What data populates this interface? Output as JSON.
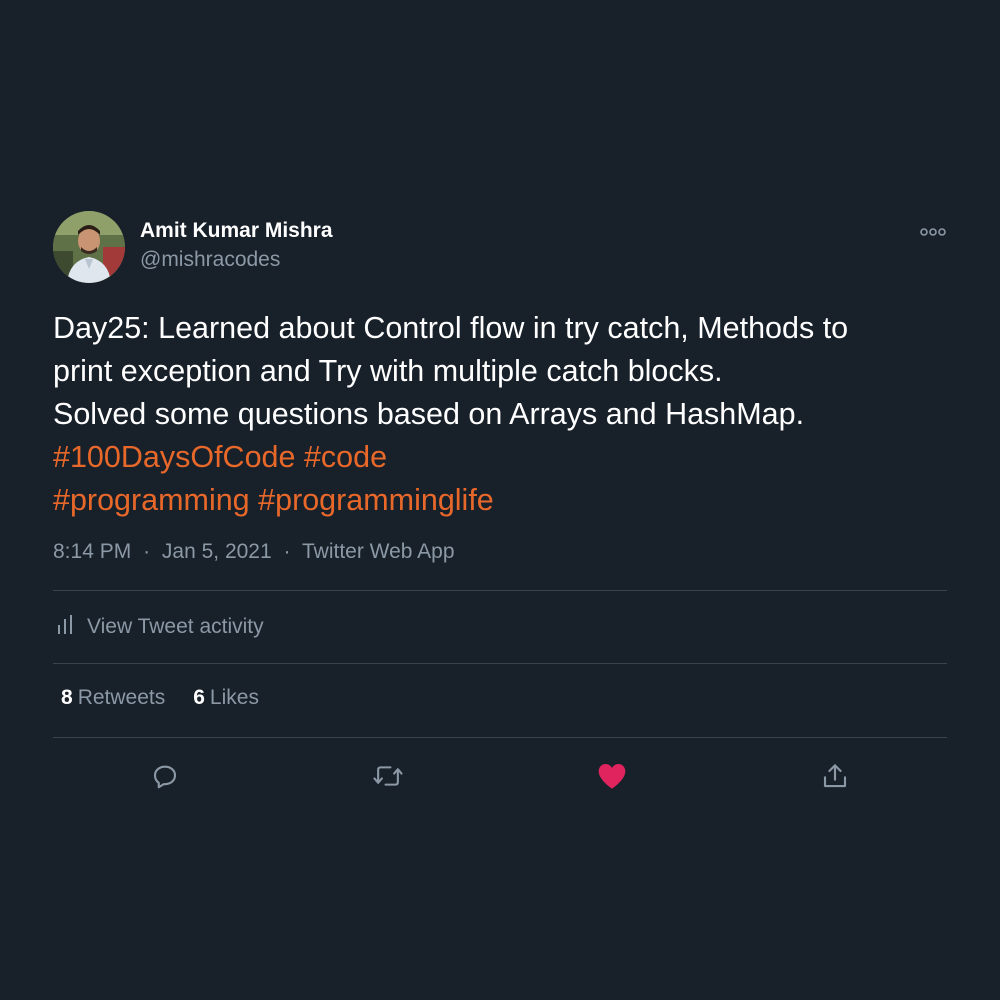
{
  "user": {
    "name": "Amit Kumar Mishra",
    "handle": "@mishracodes"
  },
  "tweet": {
    "lines": [
      "Day25: Learned about Control flow in try catch, Methods to",
      "print exception and Try with multiple catch blocks.",
      "Solved some questions based on Arrays and HashMap."
    ],
    "hashtags_line1": [
      "#100DaysOfCode",
      "#code"
    ],
    "hashtags_line2": [
      "#programming",
      "#programminglife"
    ]
  },
  "meta": {
    "time": "8:14 PM",
    "separator": "·",
    "date": "Jan 5, 2021",
    "source": "Twitter Web App"
  },
  "activity": {
    "label": "View Tweet activity"
  },
  "stats": {
    "retweets_count": "8",
    "retweets_label": "Retweets",
    "likes_count": "6",
    "likes_label": "Likes"
  },
  "colors": {
    "background": "#18202a",
    "hashtag": "#e8682a",
    "secondary_text": "#8b98a5",
    "like_active": "#e0245e",
    "divider": "#38444d"
  },
  "icons": {
    "more": "more-options-icon",
    "activity": "bar-chart-icon",
    "reply": "reply-icon",
    "retweet": "retweet-icon",
    "like": "heart-filled-icon",
    "share": "share-icon"
  }
}
